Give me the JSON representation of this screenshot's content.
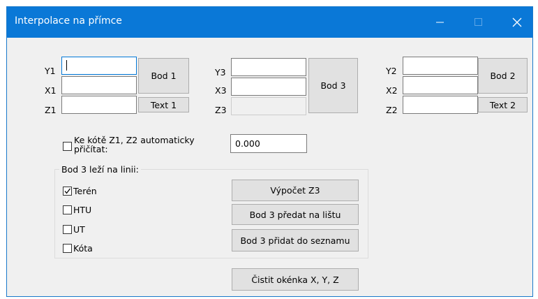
{
  "window": {
    "title": "Interpolace na přímce",
    "controls": {
      "minimize": "—",
      "maximize": "☐",
      "close": "✕"
    }
  },
  "point1": {
    "labels": {
      "y": "Y1",
      "x": "X1",
      "z": "Z1"
    },
    "values": {
      "y": "",
      "x": "",
      "z": ""
    },
    "button": "Bod 1",
    "text_button": "Text 1"
  },
  "point3": {
    "labels": {
      "y": "Y3",
      "x": "X3",
      "z": "Z3"
    },
    "values": {
      "y": "",
      "x": "",
      "z": ""
    },
    "button": "Bod 3"
  },
  "point2": {
    "labels": {
      "y": "Y2",
      "x": "X2",
      "z": "Z2"
    },
    "values": {
      "y": "",
      "x": "",
      "z": ""
    },
    "button": "Bod 2",
    "text_button": "Text 2"
  },
  "auto_add": {
    "checked": false,
    "label_line1": "Ke kótě Z1, Z2 automaticky",
    "label_line2": "přičítat:",
    "value": "0.000"
  },
  "line_group": {
    "title": "Bod 3 leží na linii:",
    "options": [
      {
        "label": "Terén",
        "checked": true
      },
      {
        "label": "HTU",
        "checked": false
      },
      {
        "label": "UT",
        "checked": false
      },
      {
        "label": "Kóta",
        "checked": false
      }
    ],
    "buttons": {
      "compute": "Výpočet Z3",
      "to_bar": "Bod 3 předat na lištu",
      "to_list": "Bod 3 přidat do seznamu"
    }
  },
  "clear_button": "Čistit okénka X, Y, Z",
  "colors": {
    "titlebar": "#0a78d7",
    "dialog_bg": "#f0f0f0",
    "button_bg": "#e1e1e1",
    "focus": "#0078d7"
  }
}
